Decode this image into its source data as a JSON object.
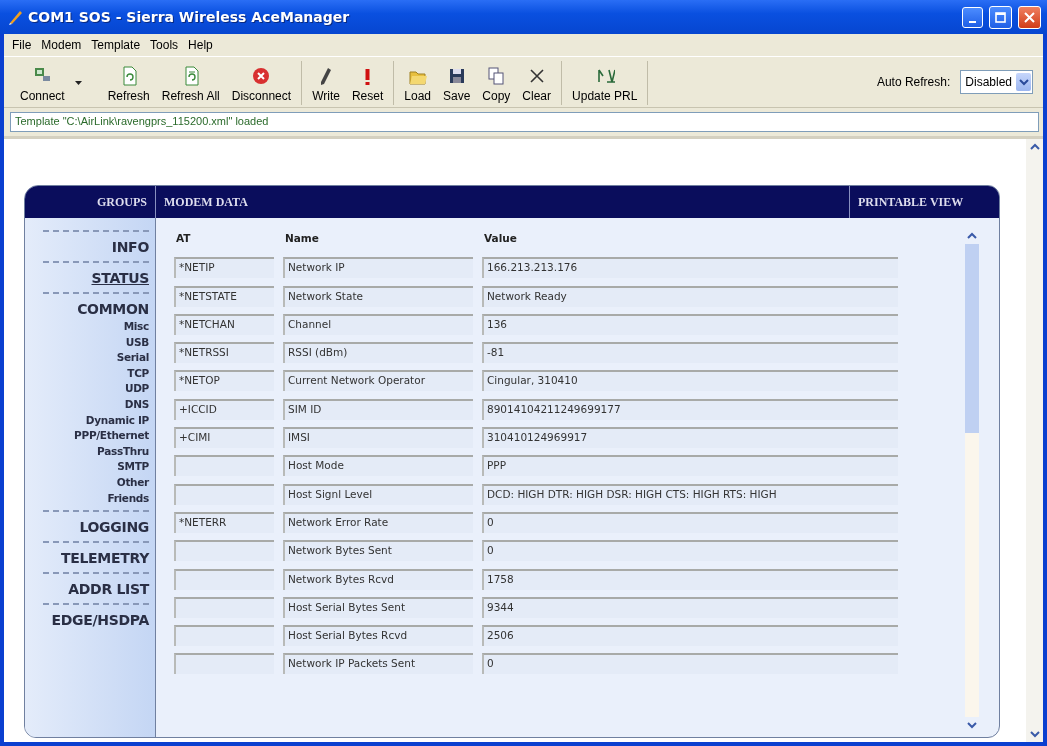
{
  "window": {
    "title": "COM1 SOS - Sierra Wireless AceManager"
  },
  "menu": [
    "File",
    "Modem",
    "Template",
    "Tools",
    "Help"
  ],
  "toolbar": [
    {
      "buttons": [
        {
          "label": "Connect",
          "dropdown": true
        },
        {
          "label": "Refresh"
        },
        {
          "label": "Refresh All"
        },
        {
          "label": "Disconnect"
        }
      ]
    },
    {
      "buttons": [
        {
          "label": "Write"
        },
        {
          "label": "Reset"
        }
      ]
    },
    {
      "buttons": [
        {
          "label": "Load"
        },
        {
          "label": "Save"
        },
        {
          "label": "Copy"
        },
        {
          "label": "Clear"
        }
      ]
    },
    {
      "buttons": [
        {
          "label": "Update PRL"
        }
      ]
    }
  ],
  "auto_refresh": {
    "label": "Auto Refresh:",
    "value": "Disabled"
  },
  "status_message": "Template \"C:\\AirLink\\ravengprs_115200.xml\" loaded",
  "panel": {
    "groups_header": "GROUPS",
    "title": "MODEM DATA",
    "printable_view": "PRINTABLE VIEW",
    "groups": [
      {
        "label": "INFO",
        "selected": false
      },
      {
        "label": "STATUS",
        "selected": true
      },
      {
        "label": "COMMON",
        "selected": false,
        "children": [
          "Misc",
          "USB",
          "Serial",
          "TCP",
          "UDP",
          "DNS",
          "Dynamic IP",
          "PPP/Ethernet",
          "PassThru",
          "SMTP",
          "Other",
          "Friends"
        ]
      },
      {
        "label": "LOGGING",
        "selected": false
      },
      {
        "label": "TELEMETRY",
        "selected": false
      },
      {
        "label": "ADDR LIST",
        "selected": false
      },
      {
        "label": "EDGE/HSDPA",
        "selected": false
      }
    ],
    "table": {
      "columns": [
        "AT",
        "Name",
        "Value"
      ],
      "rows": [
        {
          "at": "*NETIP",
          "name": "Network IP",
          "value": "166.213.213.176"
        },
        {
          "at": "*NETSTATE",
          "name": "Network State",
          "value": "Network Ready"
        },
        {
          "at": "*NETCHAN",
          "name": "Channel",
          "value": "136"
        },
        {
          "at": "*NETRSSI",
          "name": "RSSI (dBm)",
          "value": "-81"
        },
        {
          "at": "*NETOP",
          "name": "Current Network Operator",
          "value": "Cingular, 310410"
        },
        {
          "at": "+ICCID",
          "name": "SIM ID",
          "value": "89014104211249699177"
        },
        {
          "at": "+CIMI",
          "name": "IMSI",
          "value": "310410124969917"
        },
        {
          "name": "Host Mode",
          "value": "PPP"
        },
        {
          "name": "Host Signl Level",
          "value": "DCD: HIGH DTR: HIGH DSR: HIGH CTS: HIGH RTS: HIGH"
        },
        {
          "at": "*NETERR",
          "name": "Network Error Rate",
          "value": "0"
        },
        {
          "name": "Network Bytes Sent",
          "value": "0"
        },
        {
          "name": "Network Bytes Rcvd",
          "value": "1758"
        },
        {
          "name": "Host Serial Bytes Sent",
          "value": "9344"
        },
        {
          "name": "Host Serial Bytes Rcvd",
          "value": "2506"
        },
        {
          "name": "Network IP Packets Sent",
          "value": "0"
        }
      ]
    }
  }
}
